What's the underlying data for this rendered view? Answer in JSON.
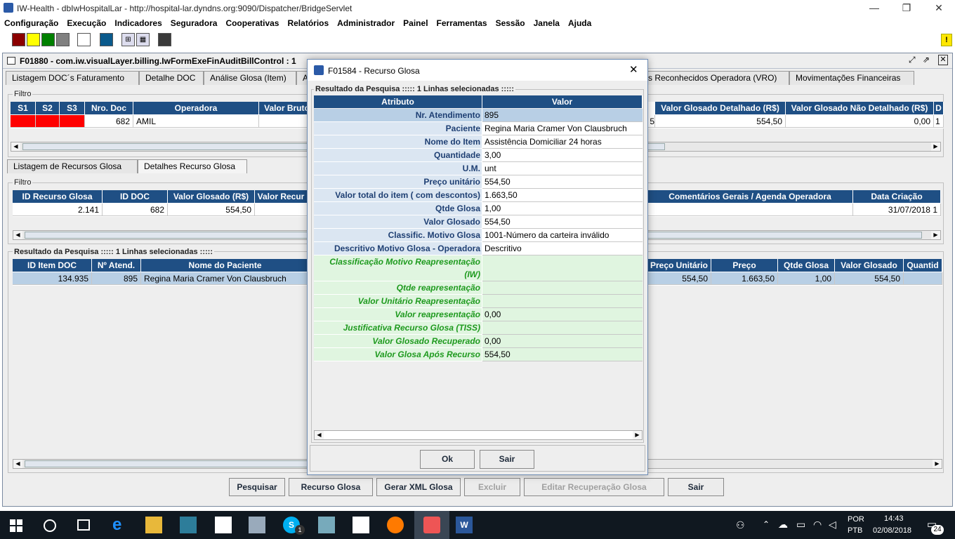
{
  "window": {
    "title": "IW-Health - dbIwHospitalLar - http://hospital-lar.dyndns.org:9090/Dispatcher/BridgeServlet",
    "minimize": "—",
    "maximize": "❐",
    "close": "✕"
  },
  "menu": [
    "Configuração",
    "Execução",
    "Indicadores",
    "Seguradora",
    "Cooperativas",
    "Relatórios",
    "Administrador",
    "Painel",
    "Ferramentas",
    "Sessão",
    "Janela",
    "Ajuda"
  ],
  "toolbar": {
    "colors": [
      "#8b0000",
      "#ffff00",
      "#008000",
      "#808080",
      "#ffffff",
      "#0a5a8c",
      "#3a3a3a"
    ],
    "alert_badge": "!"
  },
  "main_frame": {
    "title": "F01880 - com.iw.visualLayer.billing.IwFormExeFinAuditBillControl : 1",
    "tabs": [
      "Listagem DOC´s Faturamento",
      "Detalhe DOC",
      "Análise Glosa (Item)",
      "A",
      "s Reconhecidos Operadora (VRO)",
      "Movimentações Financeiras"
    ],
    "filter1": {
      "label": "Filtro",
      "headers": [
        "S1",
        "S2",
        "S3",
        "Nro. Doc",
        "Operadora",
        "Valor Bruto",
        "Valor Glosado Detalhado (R$)",
        "Valor Glosado Não Detalhado (R$)",
        "D"
      ],
      "row": {
        "nro_doc": "682",
        "operadora": "AMIL",
        "partial": "5",
        "glosado_det": "554,50",
        "glosado_nao_det": "0,00",
        "d": "1"
      }
    },
    "subtabs": [
      "Listagem de Recursos Glosa",
      "Detalhes Recurso Glosa"
    ],
    "filter2": {
      "label": "Filtro",
      "headers": [
        "ID Recurso Glosa",
        "ID DOC",
        "Valor Glosado (R$)",
        "Valor Recur",
        "Comentários Gerais / Agenda Operadora",
        "Data Criação"
      ],
      "row": {
        "id_recurso": "2.141",
        "id_doc": "682",
        "valor_glosado": "554,50",
        "data_criacao": "31/07/2018 1"
      }
    },
    "result": {
      "label": "Resultado da Pesquisa ::::: 1 Linhas selecionadas :::::",
      "headers": [
        "ID Item DOC",
        "Nº Atend.",
        "Nome do Paciente",
        "Preço Unitário",
        "Preço",
        "Qtde Glosa",
        "Valor Glosado",
        "Quantid"
      ],
      "row": {
        "id_item": "134.935",
        "atend": "895",
        "paciente": "Regina Maria Cramer Von Clausbruch",
        "preco_unit": "554,50",
        "preco": "1.663,50",
        "qtde_glosa": "1,00",
        "valor_glosado": "554,50"
      }
    },
    "buttons": [
      "Pesquisar",
      "Recurso Glosa",
      "Gerar XML Glosa",
      "Excluir",
      "Editar Recuperação Glosa",
      "Sair"
    ]
  },
  "dialog": {
    "title": "F01584 - Recurso Glosa",
    "close": "✕",
    "group_label": "Resultado da Pesquisa ::::: 1 Linhas selecionadas :::::",
    "col_attr": "Atributo",
    "col_val": "Valor",
    "rows": [
      {
        "attr": "Nr. Atendimento",
        "val": "895"
      },
      {
        "attr": "Paciente",
        "val": "Regina Maria Cramer Von Clausbruch"
      },
      {
        "attr": "Nome do Item",
        "val": "Assistência Domiciliar 24 horas"
      },
      {
        "attr": "Quantidade",
        "val": "3,00"
      },
      {
        "attr": "U.M.",
        "val": "unt"
      },
      {
        "attr": "Preço unitário",
        "val": "554,50"
      },
      {
        "attr": "Valor total do item ( com descontos)",
        "val": "1.663,50"
      },
      {
        "attr": "Qtde Glosa",
        "val": "1,00"
      },
      {
        "attr": "Valor Glosado",
        "val": "554,50"
      },
      {
        "attr": "Classific. Motivo Glosa",
        "val": "1001-Número da carteira inválido"
      },
      {
        "attr": "Descritivo Motivo Glosa - Operadora",
        "val": "Descritivo"
      },
      {
        "attr": "Classificação Motivo Reapresentação",
        "attr2": "(IW)",
        "val": ""
      },
      {
        "attr": "Qtde reapresentação",
        "val": ""
      },
      {
        "attr": "Valor Unitário Reapresentação",
        "val": ""
      },
      {
        "attr": "Valor reapresentação",
        "val": "0,00"
      },
      {
        "attr": "Justificativa Recurso Glosa (TISS)",
        "val": ""
      },
      {
        "attr": "Valor Glosado Recuperado",
        "val": "0,00"
      },
      {
        "attr": "Valor Glosa Após Recurso",
        "val": "554,50"
      }
    ],
    "ok": "Ok",
    "exit": "Sair"
  },
  "taskbar": {
    "lang1": "POR",
    "lang2": "PTB",
    "time": "14:43",
    "date": "02/08/2018",
    "notif": "24",
    "skype_badge": "1"
  }
}
